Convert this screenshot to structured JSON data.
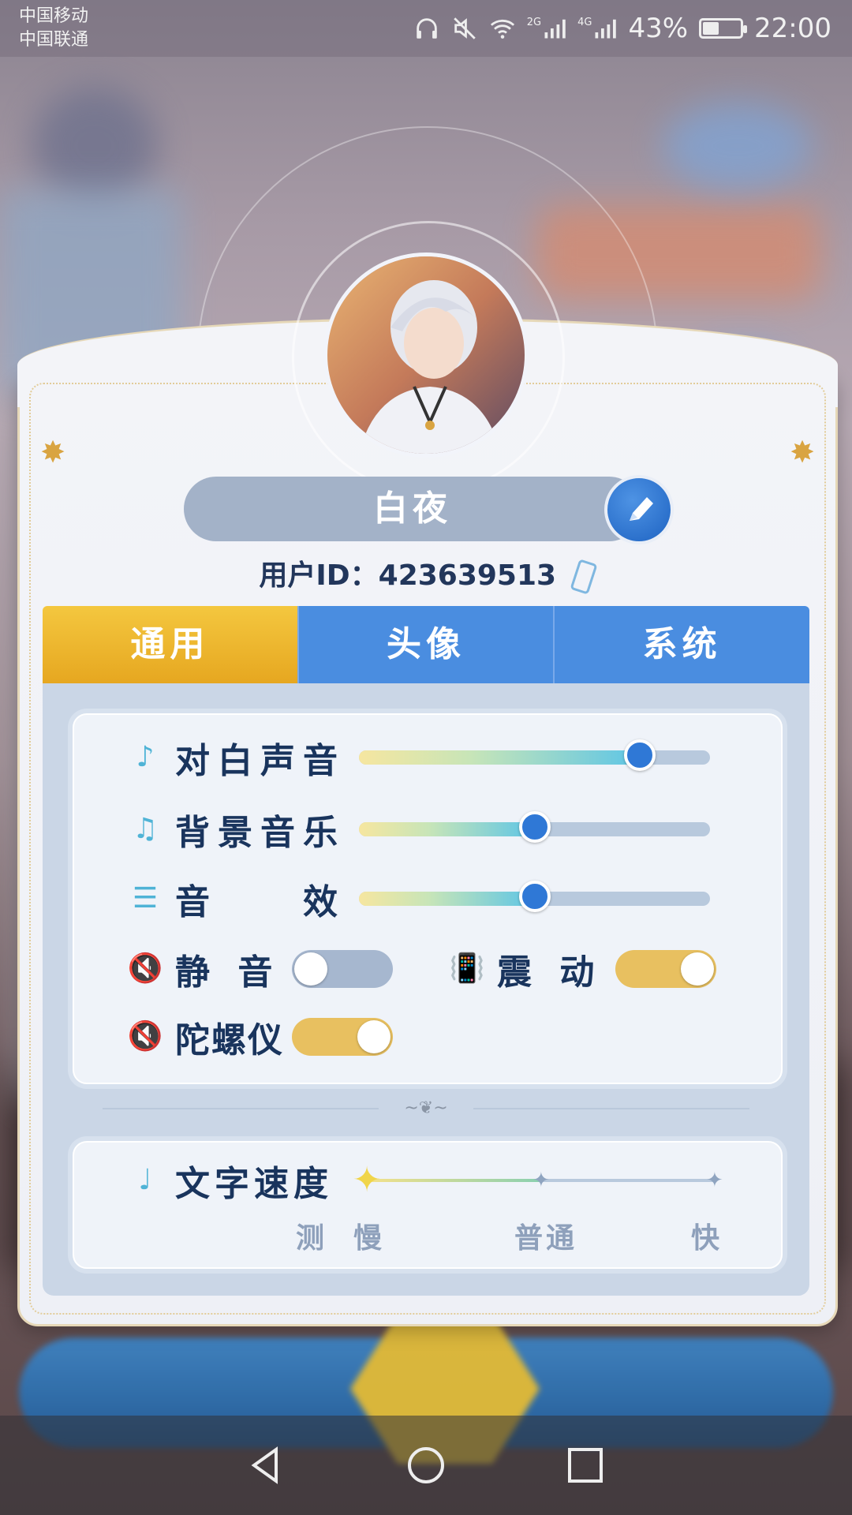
{
  "status_bar": {
    "carrier_1": "中国移动",
    "carrier_2": "中国联通",
    "net_1": "2G",
    "net_2": "4G",
    "battery": "43%",
    "battery_level": 0.43,
    "time": "22:00"
  },
  "profile": {
    "name": "白夜",
    "uid_label": "用户ID：",
    "uid_value": "423639513"
  },
  "tabs": [
    {
      "label": "通用",
      "active": true
    },
    {
      "label": "头像",
      "active": false
    },
    {
      "label": "系统",
      "active": false
    }
  ],
  "settings": {
    "dialogue_volume": {
      "label": "对白声音",
      "value": 0.8,
      "icon": "dialogue-sound-icon"
    },
    "bgm_volume": {
      "label": "背景音乐",
      "value": 0.5,
      "icon": "music-note-icon"
    },
    "sfx_volume": {
      "label": "音　　效",
      "value": 0.5,
      "icon": "equalizer-icon"
    },
    "mute": {
      "label": "静 音",
      "on": false,
      "icon": "speaker-muted-icon"
    },
    "vibrate": {
      "label": "震 动",
      "on": true,
      "icon": "vibrate-phone-icon"
    },
    "gyroscope": {
      "label": "陀螺仪",
      "on": true,
      "icon": "speaker-muted-icon"
    }
  },
  "text_speed": {
    "label": "文字速度",
    "options": [
      "测",
      "慢",
      "普通",
      "快"
    ],
    "value": 0.5
  },
  "colors": {
    "accent_blue": "#4a8de0",
    "active_tab_gold": "#e6a720",
    "label_navy": "#19345d",
    "toggle_on": "#e8c060",
    "toggle_off": "#a6b7cf"
  }
}
